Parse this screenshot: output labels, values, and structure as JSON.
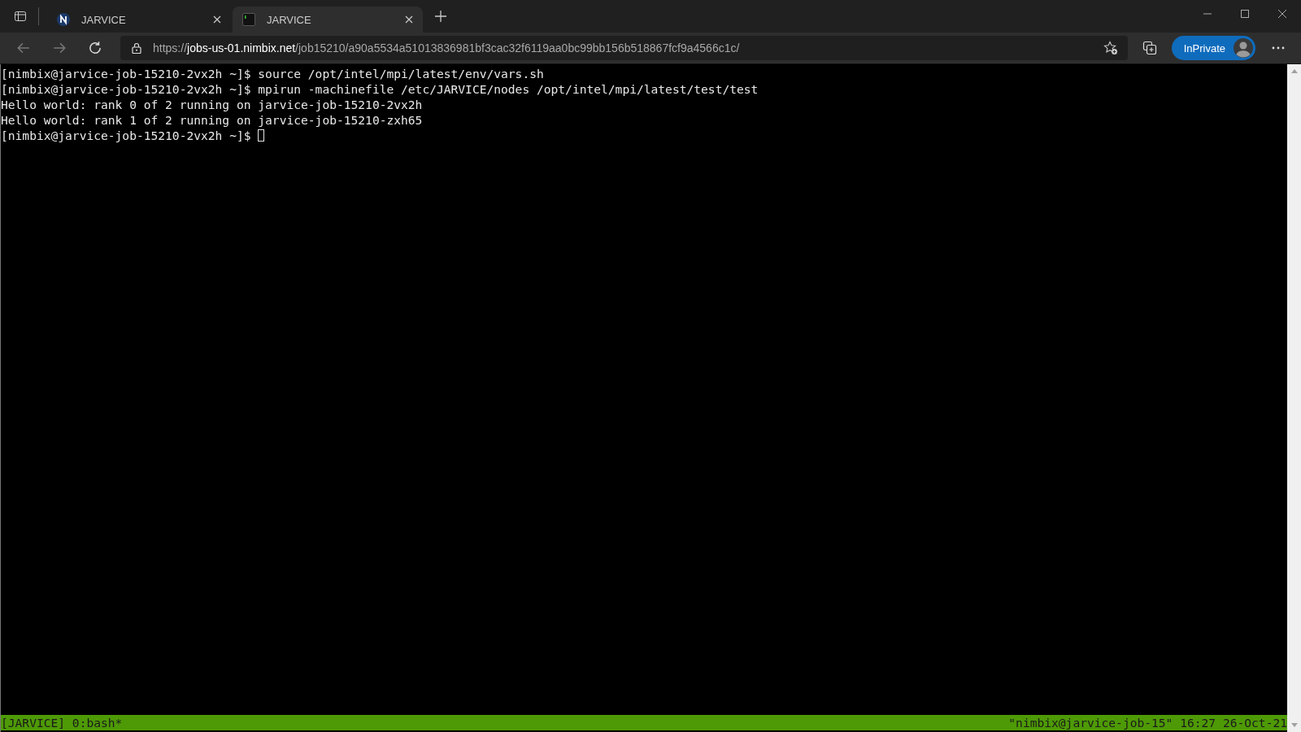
{
  "browser": {
    "tabs": [
      {
        "title": "JARVICE",
        "kind": "logo",
        "selected": false
      },
      {
        "title": "JARVICE",
        "kind": "terminal",
        "selected": true
      }
    ],
    "address": {
      "scheme": "https://",
      "host": "jobs-us-01.nimbix.net",
      "path": "/job15210/a90a5534a51013836981bf3cac32f6119aa0bc99bb156b518867fcf9a4566c1c/"
    },
    "profile_button": "InPrivate"
  },
  "terminal": {
    "lines": [
      {
        "prompt": "[nimbix@jarvice-job-15210-2vx2h ~]$ ",
        "command": "source /opt/intel/mpi/latest/env/vars.sh"
      },
      {
        "prompt": "[nimbix@jarvice-job-15210-2vx2h ~]$ ",
        "command": "mpirun -machinefile /etc/JARVICE/nodes /opt/intel/mpi/latest/test/test"
      },
      {
        "output": "Hello world: rank 0 of 2 running on jarvice-job-15210-2vx2h"
      },
      {
        "output": "Hello world: rank 1 of 2 running on jarvice-job-15210-zxh65"
      },
      {
        "prompt": "[nimbix@jarvice-job-15210-2vx2h ~]$ ",
        "cursor": true
      }
    ],
    "status_bar": {
      "left": "[JARVICE] 0:bash*",
      "right": "\"nimbix@jarvice-job-15\" 16:27 26-Oct-21"
    }
  }
}
